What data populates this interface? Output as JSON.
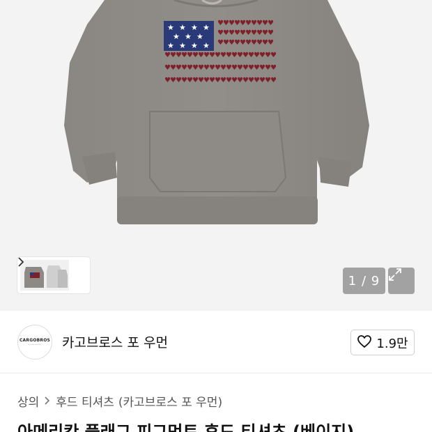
{
  "gallery": {
    "counter": "1 / 9",
    "thumb_next_icon": "chevron-right-icon",
    "expand_icon": "expand-icon"
  },
  "brand": {
    "logo_text": "CARGOBROS",
    "name": "카고브로스 포 우먼",
    "like_icon": "heart-outline-icon",
    "like_count": "1.9만"
  },
  "breadcrumb": {
    "items": [
      "상의",
      "후드 티셔츠",
      "(카고브로스 포 우먼)"
    ],
    "separator": ">"
  },
  "product": {
    "title": "아메리칸 플래그 피그먼트 후드 티셔츠 (베이지)"
  },
  "colors": {
    "hoodie": "#8d8a85",
    "flag_blue": "#2a3a78",
    "flag_red": "#7e1f2a",
    "hero_bg": "#f3f3f3"
  }
}
